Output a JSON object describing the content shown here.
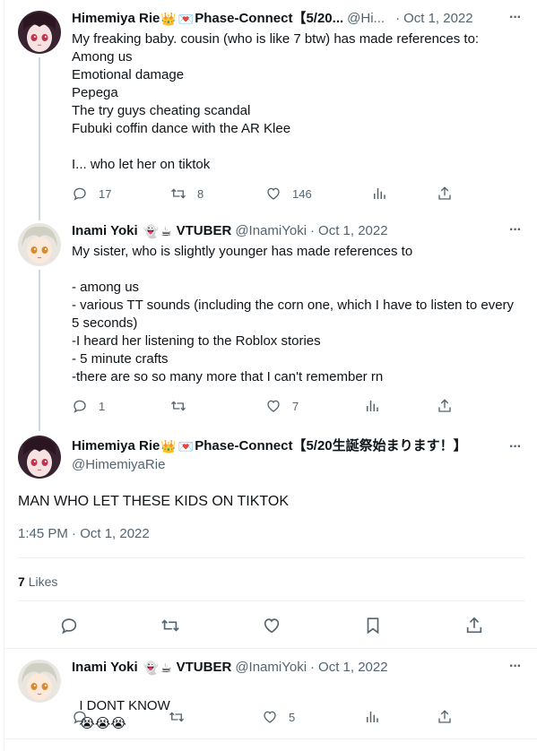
{
  "tweets": [
    {
      "display_name": "Himemiya Rie",
      "name_suffix": "Phase-Connect【5/20...",
      "handle": "@Hi...",
      "dot": "·",
      "time": "Oct 1, 2022",
      "more": "···",
      "text": "My freaking baby. cousin (who is like 7 btw) has made references to:\nAmong us\nEmotional damage\nPepega\nThe try guys cheating scandal\nFubuki coffin dance with the AR Klee\n\nI... who let her on tiktok",
      "reply_count": "17",
      "retweet_count": "8",
      "like_count": "146"
    },
    {
      "display_name": "Inami Yoki",
      "name_suffix": "VTUBER",
      "handle": "@InamiYoki",
      "dot": "·",
      "time": "Oct 1, 2022",
      "more": "···",
      "text": "My sister, who is slightly younger has made references to\n\n- among us\n- various TT sounds (including the corn one, which I have to listen to every\n5 seconds)\n-I heard her listening to the Roblox stories\n- 5 minute crafts\n-there are so so many more that I can't remember rn",
      "reply_count": "1",
      "retweet_count": "",
      "like_count": "7"
    }
  ],
  "main_tweet": {
    "display_name": "Himemiya Rie",
    "name_suffix": "Phase-Connect【5/20生誕祭始まります！】",
    "handle": "@HimemiyaRie",
    "more": "···",
    "text": "MAN WHO LET THESE KIDS ON TIKTOK",
    "timestamp": "1:45 PM · Oct 1, 2022",
    "likes_count": "7",
    "likes_label": "Likes"
  },
  "reply_tweet": {
    "display_name": "Inami Yoki",
    "name_suffix": "VTUBER",
    "handle": "@InamiYoki",
    "dot": "·",
    "time": "Oct 1, 2022",
    "more": "···",
    "text": "I DONT KNOW",
    "text_emojis": "😭😭😭",
    "like_count": "5"
  },
  "emojis": {
    "crown": "👑",
    "heart_letter": "💌",
    "ghost": "👻",
    "coffee": "☕"
  },
  "colors": {
    "text_primary": "#0f1419",
    "text_secondary": "#536471",
    "divider": "#eff3f4",
    "thread_line": "#cfd9de"
  }
}
